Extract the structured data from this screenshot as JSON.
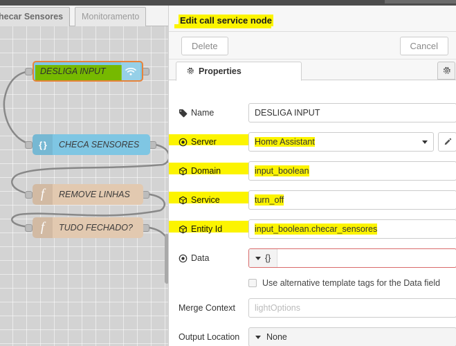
{
  "workspace": {
    "tabs": [
      {
        "label": "hecar Sensores",
        "active": true
      },
      {
        "label": "Monitoramento",
        "active": false
      }
    ],
    "nodes": [
      {
        "label": "DESLIGA INPUT",
        "icon": "wifi-icon",
        "type": "api-call-service",
        "color": "#7fc6e3",
        "selected": true,
        "highlight": "#76b900"
      },
      {
        "label": "CHECA SENSORES",
        "icon": "json-braces-icon",
        "type": "json",
        "color": "#7fc6e3"
      },
      {
        "label": "REMOVE LINHAS",
        "icon": "function-f-icon",
        "type": "function",
        "color": "#e2c9b0"
      },
      {
        "label": "TUDO FECHADO?",
        "icon": "function-f-icon",
        "type": "function",
        "color": "#e2c9b0"
      }
    ]
  },
  "dialog": {
    "title": "Edit call service node",
    "delete_label": "Delete",
    "cancel_label": "Cancel",
    "tabs": [
      {
        "label": "Properties",
        "icon": "gear-icon",
        "active": true
      }
    ],
    "form": {
      "name": {
        "label": "Name",
        "icon": "tag-icon",
        "value": "DESLIGA INPUT",
        "highlighted": false
      },
      "server": {
        "label": "Server",
        "icon": "circle-dot-icon",
        "value": "Home Assistant",
        "highlighted": true
      },
      "domain": {
        "label": "Domain",
        "icon": "cube-icon",
        "value": "input_boolean",
        "highlighted": true
      },
      "service": {
        "label": "Service",
        "icon": "cube-icon",
        "value": "turn_off",
        "highlighted": true
      },
      "entity_id": {
        "label": "Entity Id",
        "icon": "cube-icon",
        "value": "input_boolean.checar_sensores",
        "highlighted": true
      },
      "data": {
        "label": "Data",
        "icon": "circle-dot-icon",
        "type_label": "{}",
        "value": "",
        "error": true
      },
      "alt_template_tags": {
        "label": "Use alternative template tags for the Data field",
        "checked": false
      },
      "merge_context": {
        "label": "Merge Context",
        "value": "",
        "placeholder": "lightOptions"
      },
      "output_location": {
        "label": "Output Location",
        "value": "None"
      }
    }
  },
  "colors": {
    "highlight_yellow": "#fcf400",
    "node_blue": "#7fc6e3",
    "node_tan": "#e2c9b0",
    "selection_orange": "#e8833a",
    "error_red": "#d96a6a",
    "green_highlight": "#76b900"
  }
}
